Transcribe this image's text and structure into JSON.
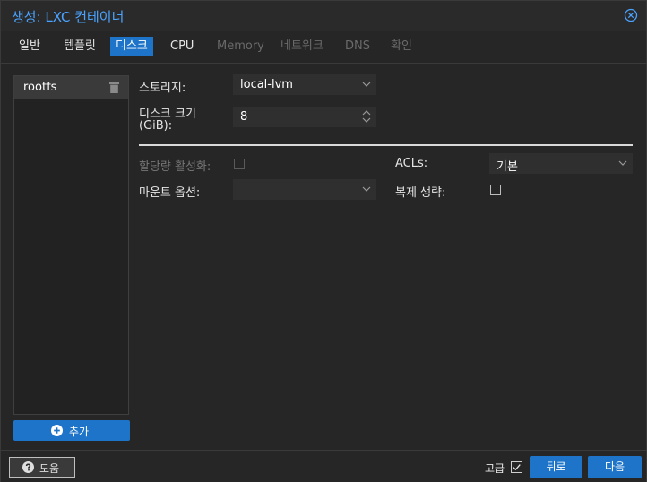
{
  "window": {
    "title": "생성: LXC 컨테이너"
  },
  "tabs": [
    {
      "label": "일반",
      "state": "normal"
    },
    {
      "label": "템플릿",
      "state": "normal"
    },
    {
      "label": "디스크",
      "state": "active"
    },
    {
      "label": "CPU",
      "state": "normal"
    },
    {
      "label": "Memory",
      "state": "disabled"
    },
    {
      "label": "네트워크",
      "state": "disabled"
    },
    {
      "label": "DNS",
      "state": "disabled"
    },
    {
      "label": "확인",
      "state": "disabled"
    }
  ],
  "disks": {
    "items": [
      {
        "label": "rootfs"
      }
    ],
    "add_label": "추가"
  },
  "form": {
    "storage": {
      "label": "스토리지:",
      "value": "local-lvm"
    },
    "disk_size": {
      "label_line1": "디스크 크기",
      "label_line2": "(GiB):",
      "value": "8"
    },
    "quota": {
      "label": "할당량 활성화:",
      "checked": false,
      "disabled": true
    },
    "mount_options": {
      "label": "마운트 옵션:",
      "value": ""
    },
    "acls": {
      "label": "ACLs:",
      "value": "기본"
    },
    "skip_replication": {
      "label": "복제 생략:",
      "checked": false
    }
  },
  "footer": {
    "help_label": "도움",
    "advanced_label": "고급",
    "advanced_checked": true,
    "back_label": "뒤로",
    "next_label": "다음"
  },
  "colors": {
    "accent": "#1e74c8",
    "title": "#4aa3ff",
    "background": "#262626"
  }
}
